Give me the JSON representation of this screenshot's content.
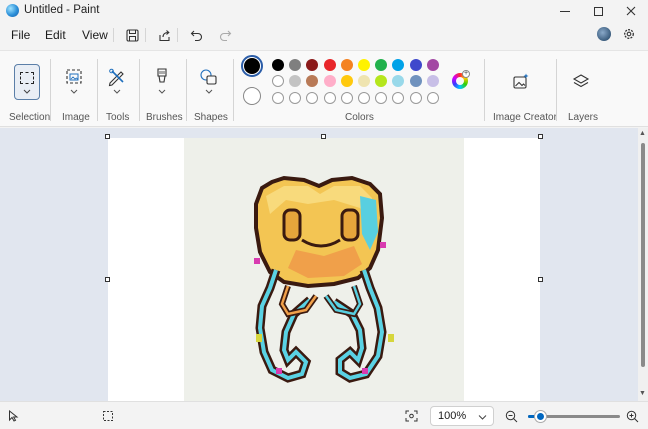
{
  "window": {
    "title": "Untitled - Paint"
  },
  "menu": {
    "file": "File",
    "edit": "Edit",
    "view": "View"
  },
  "ribbon": {
    "groups": {
      "selection": "Selection",
      "image": "Image",
      "tools": "Tools",
      "brushes": "Brushes",
      "shapes": "Shapes",
      "colors": "Colors",
      "image_creator": "Image Creator",
      "layers": "Layers"
    },
    "palette_row1": [
      "#000000",
      "#7f7f7f",
      "#8b1a1a",
      "#e8262a",
      "#f48221",
      "#fff200",
      "#22b14c",
      "#00a2e8",
      "#3f48cc",
      "#a349a4"
    ],
    "palette_row2": [
      "#ffffff",
      "#c3c3c3",
      "#b97a57",
      "#ffaec9",
      "#ffc90e",
      "#efe4b0",
      "#b5e61d",
      "#99d9ea",
      "#7092be",
      "#c8bfe7"
    ],
    "custom_slots": 10,
    "primary_color": "#000000",
    "secondary_color": "#ffffff"
  },
  "status": {
    "zoom": "100%",
    "zoom_fraction": 0.25
  },
  "colors": {
    "accent": "#0067c0",
    "workspace": "#e1e6ef",
    "ribbon_bg": "#f9f9f9"
  }
}
